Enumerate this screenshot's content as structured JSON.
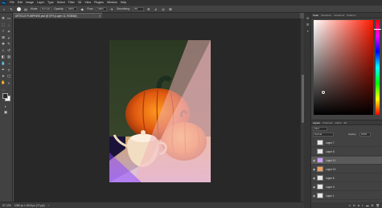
{
  "menu": {
    "logo": "Ps",
    "items": [
      "File",
      "Edit",
      "Image",
      "Layer",
      "Type",
      "Select",
      "Filter",
      "3D",
      "View",
      "Plugins",
      "Window",
      "Help"
    ]
  },
  "options": {
    "mode_label": "Mode:",
    "mode_value": "Normal",
    "opacity_label": "Opacity:",
    "opacity_value": "100%",
    "flow_label": "Flow:",
    "flow_value": "100%",
    "smoothing_label": "Smoothing:",
    "smoothing_value": "0%"
  },
  "document": {
    "tab_title": "ARTICLE PUMPKINS.psd @ 57% (Layer 11, RGB/8#)",
    "zoom": "57.12%",
    "dimensions": "1080 px x 1615 px (72 ppi)"
  },
  "panels": {
    "top_tabs": [
      "Color",
      "Swatches",
      "Gradients",
      "Patterns"
    ],
    "layer_tabs": [
      "Layers",
      "Channels",
      "Paths",
      "3D"
    ],
    "kind_label": "Kind",
    "blend_value": "Normal",
    "opacity_label": "Opacity:",
    "opacity_value": "100%",
    "fill_label": "Fill:",
    "fill_value": "100%",
    "lock_label": "Lock:"
  },
  "layers": [
    {
      "name": "Layer 7",
      "visible": false,
      "selected": false
    },
    {
      "name": "Layer 8",
      "visible": false,
      "selected": false
    },
    {
      "name": "Layer 11",
      "visible": true,
      "selected": true
    },
    {
      "name": "Layer 10",
      "visible": true,
      "selected": false
    },
    {
      "name": "Layer 6",
      "visible": true,
      "selected": false
    },
    {
      "name": "Layer 4",
      "visible": true,
      "selected": false
    },
    {
      "name": "Layer 1",
      "visible": true,
      "selected": false
    }
  ],
  "colors": {
    "accent": "#31a8ff",
    "foreground": "#2a2a2a",
    "background": "#ffffff"
  }
}
